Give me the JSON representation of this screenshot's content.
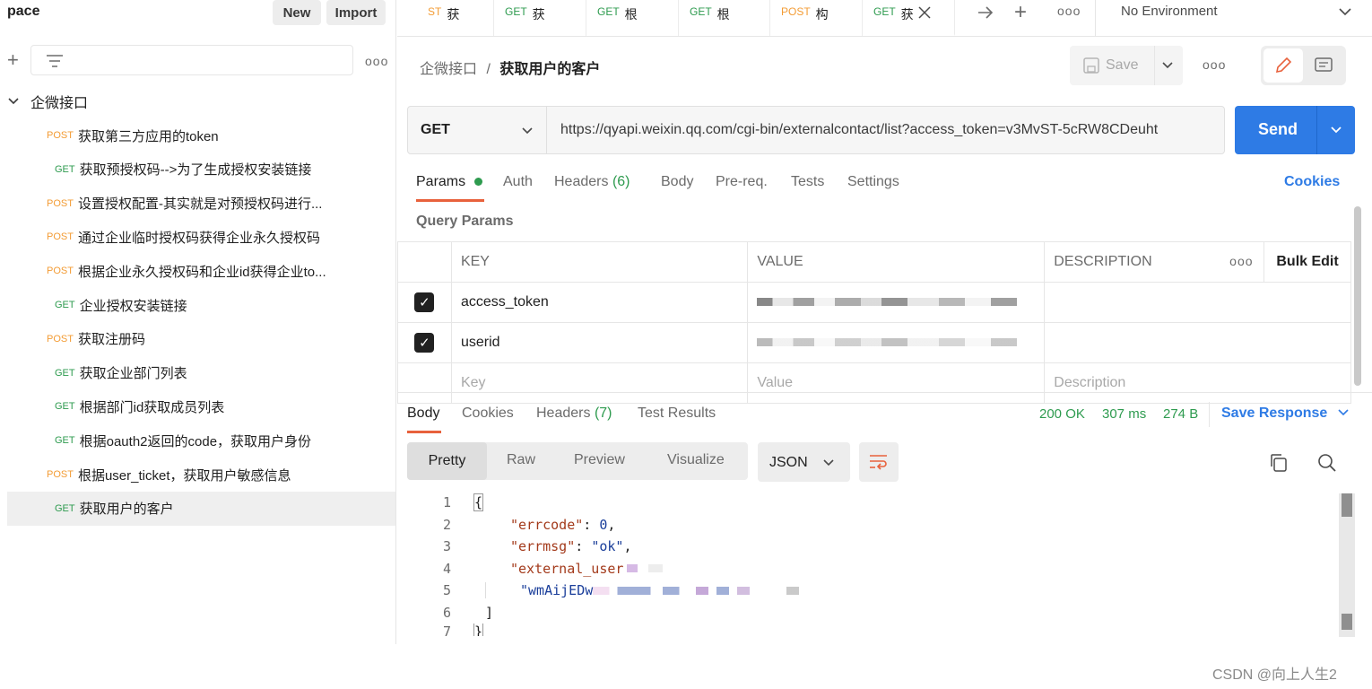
{
  "sidebar": {
    "workspace_title": "pace",
    "new_label": "New",
    "import_label": "Import",
    "plus": "+",
    "more": "ooo",
    "collection_name": "企微接口",
    "requests": [
      {
        "method": "POST",
        "name": "获取第三方应用的token"
      },
      {
        "method": "GET",
        "name": "获取预授权码-->为了生成授权安装链接"
      },
      {
        "method": "POST",
        "name": "设置授权配置-其实就是对预授权码进行..."
      },
      {
        "method": "POST",
        "name": "通过企业临时授权码获得企业永久授权码"
      },
      {
        "method": "POST",
        "name": "根据企业永久授权码和企业id获得企业to..."
      },
      {
        "method": "GET",
        "name": "企业授权安装链接"
      },
      {
        "method": "POST",
        "name": "获取注册码"
      },
      {
        "method": "GET",
        "name": "获取企业部门列表"
      },
      {
        "method": "GET",
        "name": "根据部门id获取成员列表"
      },
      {
        "method": "GET",
        "name": "根据oauth2返回的code，获取用户身份"
      },
      {
        "method": "POST",
        "name": "根据user_ticket，获取用户敏感信息"
      },
      {
        "method": "GET",
        "name": "获取用户的客户"
      }
    ]
  },
  "tabs": [
    {
      "method": "ST",
      "name": "获"
    },
    {
      "method": "GET",
      "name": "获"
    },
    {
      "method": "GET",
      "name": "根"
    },
    {
      "method": "GET",
      "name": "根"
    },
    {
      "method": "POST",
      "name": "构"
    },
    {
      "method": "GET",
      "name": "获"
    }
  ],
  "tabbar": {
    "plus": "+",
    "more": "ooo",
    "environment": "No Environment"
  },
  "breadcrumb": {
    "collection": "企微接口",
    "separator": "/",
    "request": "获取用户的客户"
  },
  "toolbar": {
    "save_label": "Save",
    "more": "ooo"
  },
  "request": {
    "method": "GET",
    "url": "https://qyapi.weixin.qq.com/cgi-bin/externalcontact/list?access_token=v3MvST-5cRW8CDeuht",
    "send_label": "Send"
  },
  "request_tabs": {
    "params": "Params",
    "auth": "Auth",
    "headers": "Headers",
    "headers_count": "(6)",
    "body": "Body",
    "prereq": "Pre-req.",
    "tests": "Tests",
    "settings": "Settings",
    "cookies": "Cookies"
  },
  "query_params": {
    "title": "Query Params",
    "col_key": "KEY",
    "col_value": "VALUE",
    "col_description": "DESCRIPTION",
    "more": "ooo",
    "bulk_edit": "Bulk Edit",
    "rows": [
      {
        "key": "access_token"
      },
      {
        "key": "userid"
      }
    ],
    "placeholder_key": "Key",
    "placeholder_value": "Value",
    "placeholder_description": "Description"
  },
  "response_tabs": {
    "body": "Body",
    "cookies": "Cookies",
    "headers": "Headers",
    "headers_count": "(7)",
    "test_results": "Test Results"
  },
  "response_meta": {
    "status": "200 OK",
    "time": "307 ms",
    "size": "274 B",
    "save_response": "Save Response"
  },
  "format": {
    "pretty": "Pretty",
    "raw": "Raw",
    "preview": "Preview",
    "visualize": "Visualize",
    "language": "JSON"
  },
  "code": {
    "line_numbers": [
      "1",
      "2",
      "3",
      "4",
      "5",
      "6",
      "7"
    ],
    "l1": "{",
    "l2_key": "\"errcode\"",
    "l2_val": "0",
    "l3_key": "\"errmsg\"",
    "l3_val": "\"ok\"",
    "l4_key": "\"external_user",
    "l5_val": "\"wmAijEDw",
    "l6": "]",
    "l7": "}"
  },
  "watermark": "CSDN @向上人生2",
  "colors": {
    "accent": "#2e7be5",
    "post": "#f39c35",
    "get": "#2e9b4f",
    "status_ok": "#2e9b4f",
    "active_tab": "#e8613c"
  }
}
